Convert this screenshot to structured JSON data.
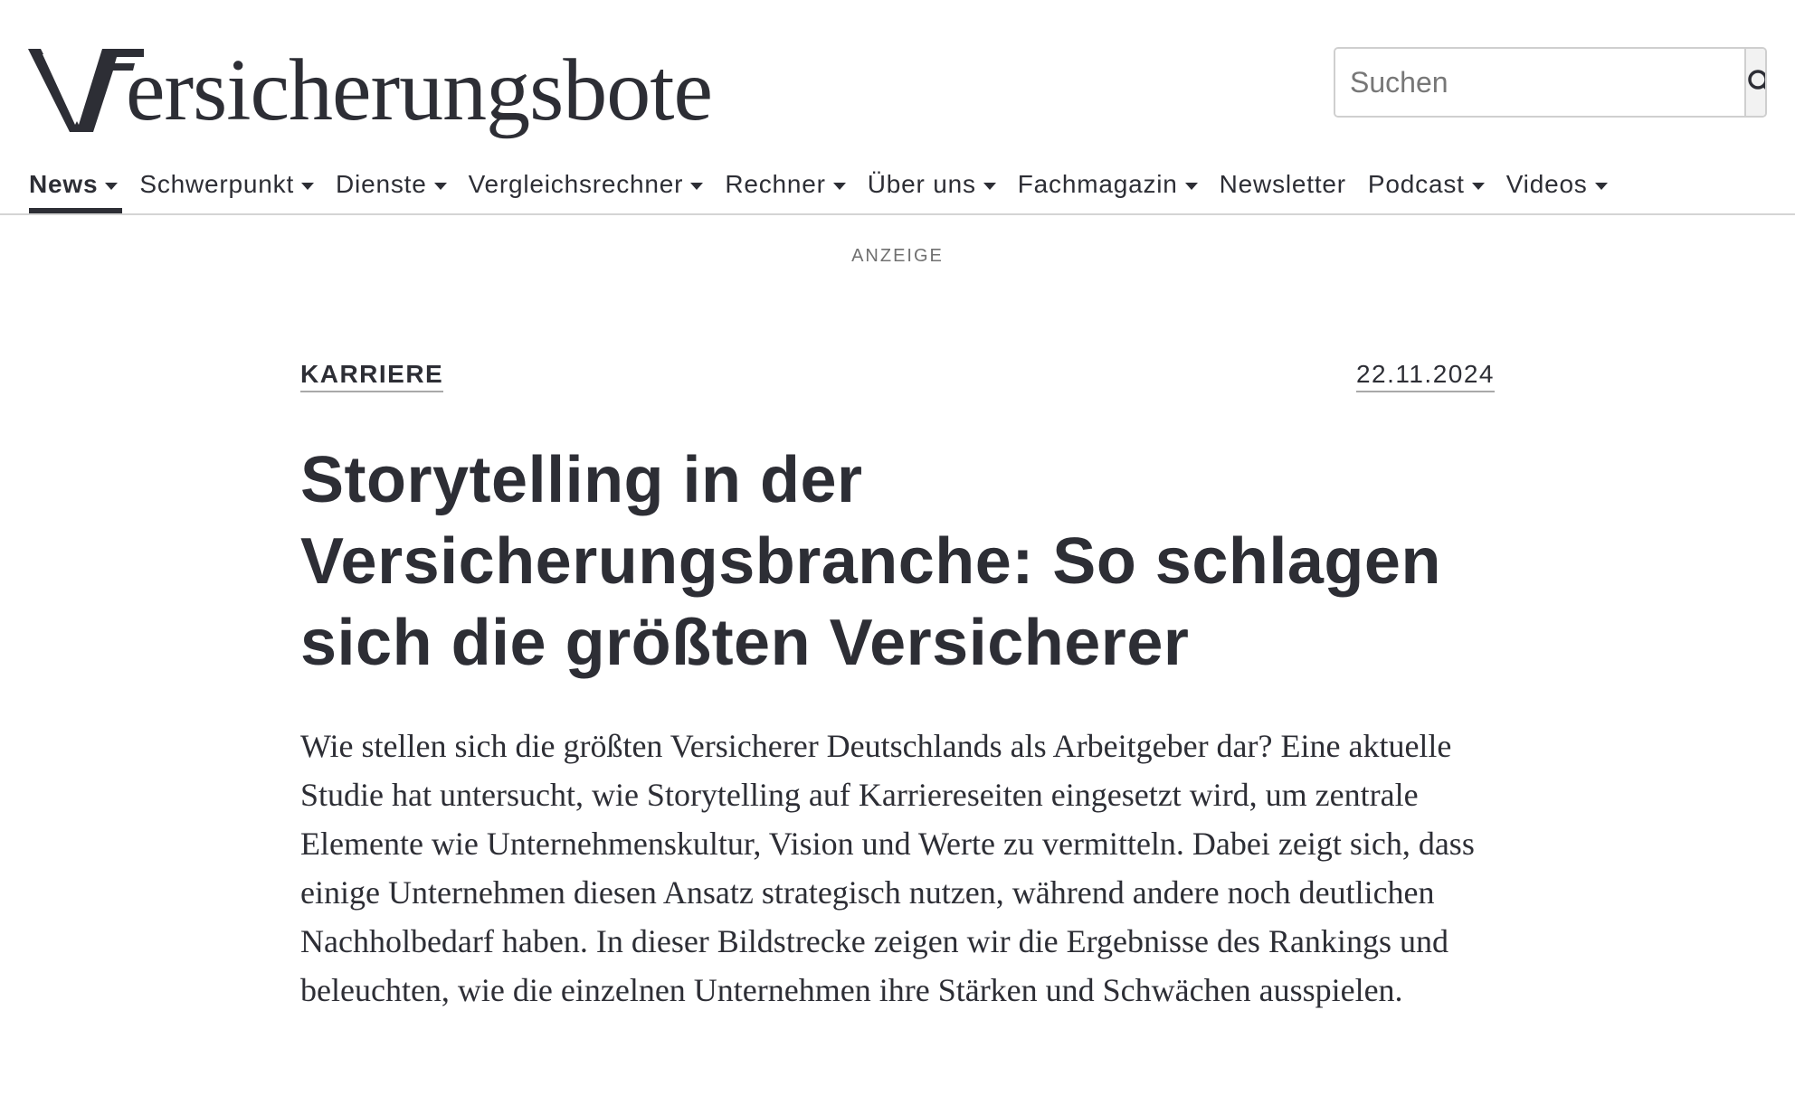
{
  "header": {
    "logo_text": "ersicherungsbote",
    "search": {
      "placeholder": "Suchen"
    }
  },
  "nav": {
    "items": [
      {
        "label": "News",
        "has_dropdown": true,
        "active": true
      },
      {
        "label": "Schwerpunkt",
        "has_dropdown": true
      },
      {
        "label": "Dienste",
        "has_dropdown": true
      },
      {
        "label": "Vergleichsrechner",
        "has_dropdown": true
      },
      {
        "label": "Rechner",
        "has_dropdown": true
      },
      {
        "label": "Über uns",
        "has_dropdown": true
      },
      {
        "label": "Fachmagazin",
        "has_dropdown": true
      },
      {
        "label": "Newsletter",
        "has_dropdown": false
      },
      {
        "label": "Podcast",
        "has_dropdown": true
      },
      {
        "label": "Videos",
        "has_dropdown": true
      }
    ]
  },
  "ad_label": "ANZEIGE",
  "article": {
    "category": "KARRIERE",
    "date": "22.11.2024",
    "headline": "Storytelling in der Versicherungsbranche: So schlagen sich die größten Versicherer",
    "lead": "Wie stellen sich die größten Versicherer Deutschlands als Arbeitgeber dar? Eine aktuelle Studie hat untersucht, wie Storytelling auf Karriereseiten eingesetzt wird, um zentrale Elemente wie Unternehmenskultur, Vision und Werte zu vermitteln. Dabei zeigt sich, dass einige Unternehmen diesen Ansatz strategisch nutzen, während andere noch deutlichen Nachholbedarf haben. In dieser Bildstrecke zeigen wir die Ergebnisse des Rankings und beleuchten, wie die einzelnen Unternehmen ihre Stärken und Schwächen ausspielen."
  },
  "colors": {
    "text": "#2d2e35",
    "rule": "#d4d4d4",
    "muted": "#707070"
  }
}
